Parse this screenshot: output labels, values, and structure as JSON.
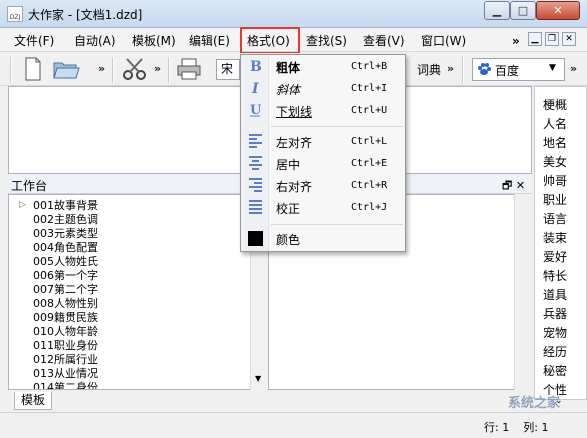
{
  "window": {
    "title": "大作家 - [文档1.dzd]",
    "app_icon_text": "DZJ"
  },
  "menubar": {
    "items": [
      "文件(F)",
      "自动(A)",
      "模板(M)",
      "编辑(E)",
      "格式(O)",
      "查找(S)",
      "查看(V)",
      "窗口(W)"
    ],
    "more": "»"
  },
  "toolbar": {
    "font_fragment": "宋",
    "dict_label": "词典",
    "search_engine": "百度",
    "chevron": "»"
  },
  "format_menu": {
    "items": [
      {
        "label": "粗体",
        "shortcut": "Ctrl+B",
        "icon": "bold-icon"
      },
      {
        "label": "斜体",
        "shortcut": "Ctrl+I",
        "icon": "italic-icon"
      },
      {
        "label": "下划线",
        "shortcut": "Ctrl+U",
        "icon": "underline-icon"
      },
      {
        "label": "左对齐",
        "shortcut": "Ctrl+L",
        "icon": "align-left-icon"
      },
      {
        "label": "居中",
        "shortcut": "Ctrl+E",
        "icon": "align-center-icon"
      },
      {
        "label": "右对齐",
        "shortcut": "Ctrl+R",
        "icon": "align-right-icon"
      },
      {
        "label": "校正",
        "shortcut": "Ctrl+J",
        "icon": "justify-icon"
      },
      {
        "label": "颜色",
        "shortcut": "",
        "icon": "color-swatch-icon"
      }
    ]
  },
  "right_panel": {
    "items": [
      "梗概",
      "人名",
      "地名",
      "美女",
      "帅哥",
      "职业",
      "语言",
      "装束",
      "爱好",
      "特长",
      "道具",
      "兵器",
      "宠物",
      "经历",
      "秘密",
      "个性"
    ]
  },
  "workbench": {
    "title": "工作台",
    "tree_items": [
      "001故事背景",
      "002主题色调",
      "003元素类型",
      "004角色配置",
      "005人物姓氏",
      "006第一个字",
      "007第二个字",
      "008人物性别",
      "009籍贯民族",
      "010人物年龄",
      "011职业身份",
      "012所属行业",
      "013从业情况",
      "014第二身份"
    ]
  },
  "tabs": {
    "active": "模板"
  },
  "status": {
    "row_label": "行:",
    "row_value": "1",
    "col_label": "列:",
    "col_value": "1"
  },
  "watermark": "系统之家",
  "colors": {
    "highlight_border": "#e53935",
    "menu_icon_blue": "#5b7fc0"
  }
}
